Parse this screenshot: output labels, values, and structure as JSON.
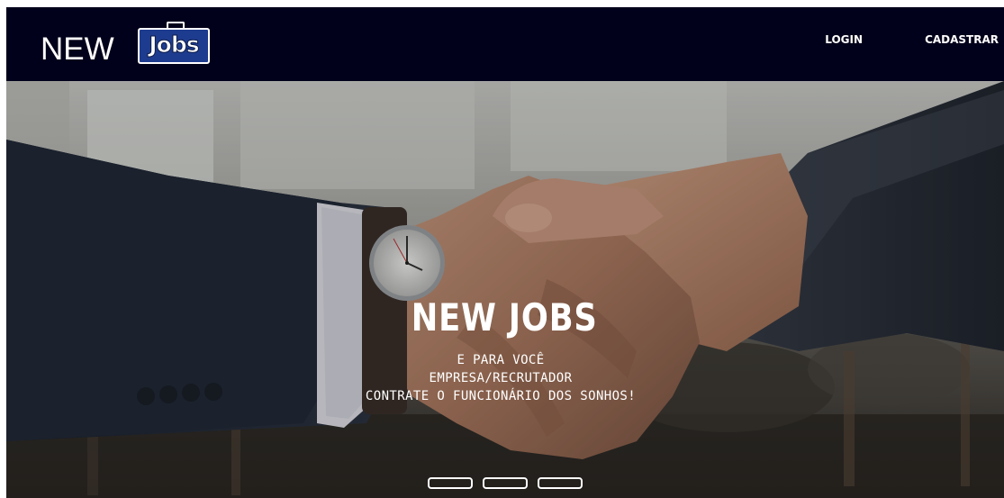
{
  "navbar": {
    "logo": {
      "new_text": "NEW",
      "jobs_text": "Jobs"
    },
    "links": [
      {
        "label": "LOGIN"
      },
      {
        "label": "CADASTRAR"
      }
    ]
  },
  "hero": {
    "title": "NEW JOBS",
    "lines": [
      "E PARA VOCÊ",
      "EMPRESA/RECRUTADOR",
      "CONTRATE O FUNCIONÁRIO DOS SONHOS!"
    ],
    "background": "handshake-photo",
    "carousel": {
      "slide_count": 3
    }
  },
  "colors": {
    "navbar_bg": "#02011b",
    "logo_badge": "#1e3c8f",
    "text": "#ffffff"
  }
}
